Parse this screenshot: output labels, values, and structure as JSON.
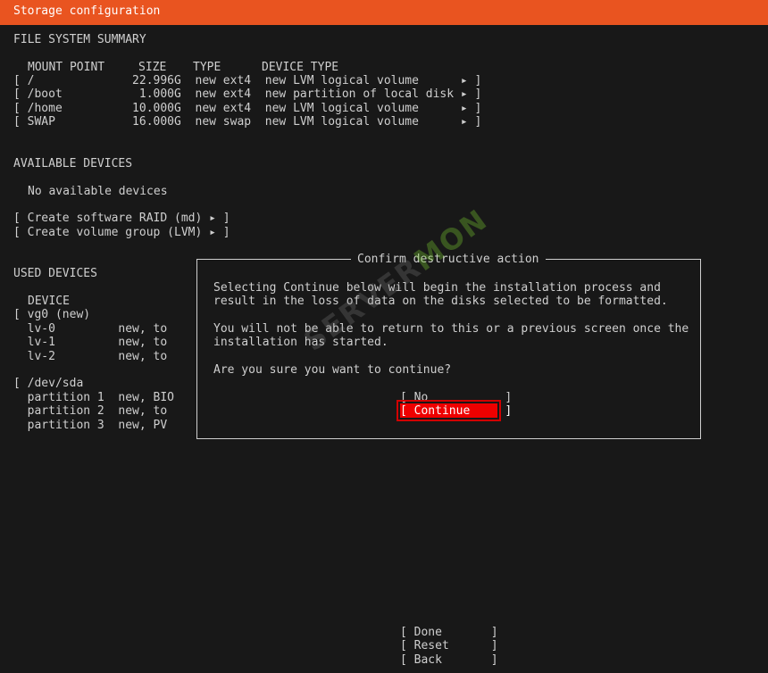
{
  "header": {
    "title": "Storage configuration"
  },
  "fs_summary": {
    "heading": "FILE SYSTEM SUMMARY",
    "columns": [
      "MOUNT POINT",
      "SIZE",
      "TYPE",
      "DEVICE TYPE"
    ],
    "rows": [
      {
        "line": "[ /              22.996G  new ext4  new LVM logical volume      ▸ ]"
      },
      {
        "line": "[ /boot           1.000G  new ext4  new partition of local disk ▸ ]"
      },
      {
        "line": "[ /home          10.000G  new ext4  new LVM logical volume      ▸ ]"
      },
      {
        "line": "[ SWAP           16.000G  new swap  new LVM logical volume      ▸ ]"
      }
    ]
  },
  "available": {
    "heading": "AVAILABLE DEVICES",
    "empty_text": "No available devices",
    "raid": "[ Create software RAID (md) ▸ ]",
    "vg": "[ Create volume group (LVM) ▸ ]"
  },
  "used": {
    "heading": "USED DEVICES",
    "col_device": "DEVICE",
    "lines": [
      "[ vg0 (new)",
      "  lv-0         new, to",
      "  lv-1         new, to",
      "  lv-2         new, to",
      "",
      "[ /dev/sda",
      "  partition 1  new, BIO",
      "  partition 2  new, to",
      "  partition 3  new, PV"
    ]
  },
  "dialog": {
    "title": "Confirm destructive action",
    "line1": "Selecting Continue below will begin the installation process and",
    "line2": "result in the loss of data on the disks selected to be formatted.",
    "line3": "You will not be able to return to this or a previous screen once the",
    "line4": "installation has started.",
    "question": "Are you sure you want to continue?",
    "no_label": "[ No           ]",
    "continue_label": "[ Continue     ]"
  },
  "footer": {
    "done": "[ Done       ]",
    "reset": "[ Reset      ]",
    "back": "[ Back       ]"
  },
  "watermark": {
    "prefix": "SERVER",
    "accent": "MON"
  },
  "colors": {
    "accent": "#e95420",
    "selection": "#ee0000",
    "background": "#181818",
    "text": "#cfcfcf"
  }
}
